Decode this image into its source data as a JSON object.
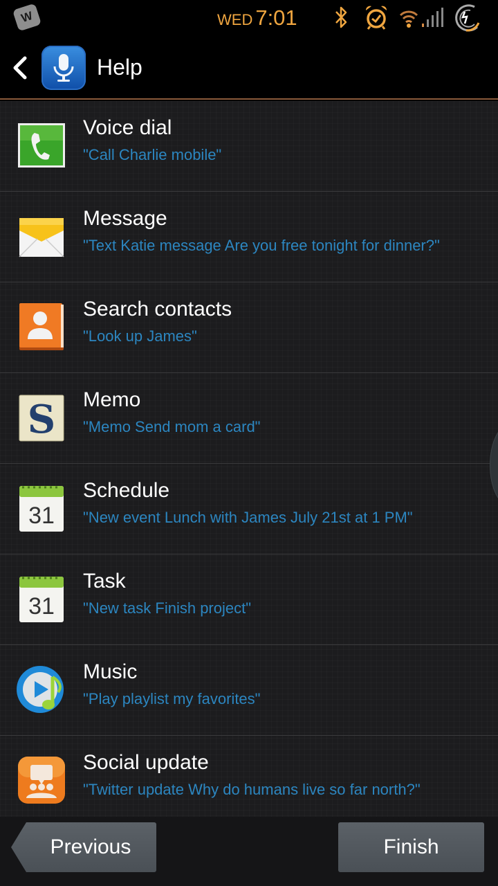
{
  "status_bar": {
    "notification_icon_letter": "W",
    "day": "WED",
    "time": "7:01",
    "icons": [
      "bluetooth-icon",
      "alarm-icon",
      "wifi-icon",
      "signal-icon",
      "battery-charging-icon"
    ],
    "accent_color": "#f0a640"
  },
  "action_bar": {
    "back_icon": "chevron-left-icon",
    "app_icon": "microphone-icon",
    "title": "Help"
  },
  "commands": [
    {
      "title": "Voice dial",
      "example": "\"Call Charlie mobile\"",
      "icon": "phone-icon"
    },
    {
      "title": "Message",
      "example": "\"Text Katie message Are you free tonight for dinner?\"",
      "icon": "envelope-icon"
    },
    {
      "title": "Search contacts",
      "example": "\"Look up James\"",
      "icon": "contact-icon"
    },
    {
      "title": "Memo",
      "example": "\"Memo Send mom a card\"",
      "icon": "memo-icon"
    },
    {
      "title": "Schedule",
      "example": "\"New event Lunch with James July 21st at 1 PM\"",
      "icon": "calendar-icon",
      "calendar_day": "31"
    },
    {
      "title": "Task",
      "example": "\"New task Finish project\"",
      "icon": "calendar-icon",
      "calendar_day": "31"
    },
    {
      "title": "Music",
      "example": "\"Play playlist my favorites\"",
      "icon": "music-icon"
    },
    {
      "title": "Social update",
      "example": "\"Twitter update Why do humans live so far north?\"",
      "icon": "social-icon"
    }
  ],
  "memo_letter": "S",
  "buttons": {
    "previous": "Previous",
    "finish": "Finish"
  },
  "colors": {
    "example_text": "#2c86c0",
    "divider_accent": "#8a5a3a"
  }
}
